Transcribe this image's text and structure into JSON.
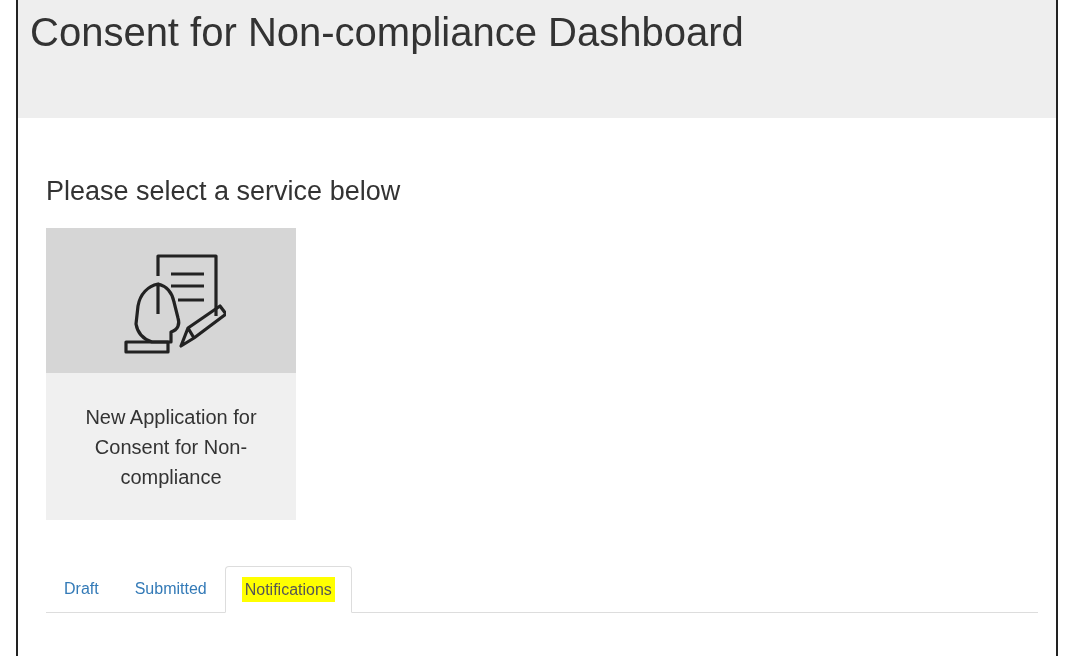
{
  "header": {
    "title": "Consent for Non-compliance Dashboard"
  },
  "prompt": "Please select a service below",
  "services": [
    {
      "label": "New Application for Consent for Non-compliance"
    }
  ],
  "tabs": [
    {
      "label": "Draft",
      "selected": false,
      "highlighted": false
    },
    {
      "label": "Submitted",
      "selected": false,
      "highlighted": false
    },
    {
      "label": "Notifications",
      "selected": true,
      "highlighted": true
    }
  ]
}
